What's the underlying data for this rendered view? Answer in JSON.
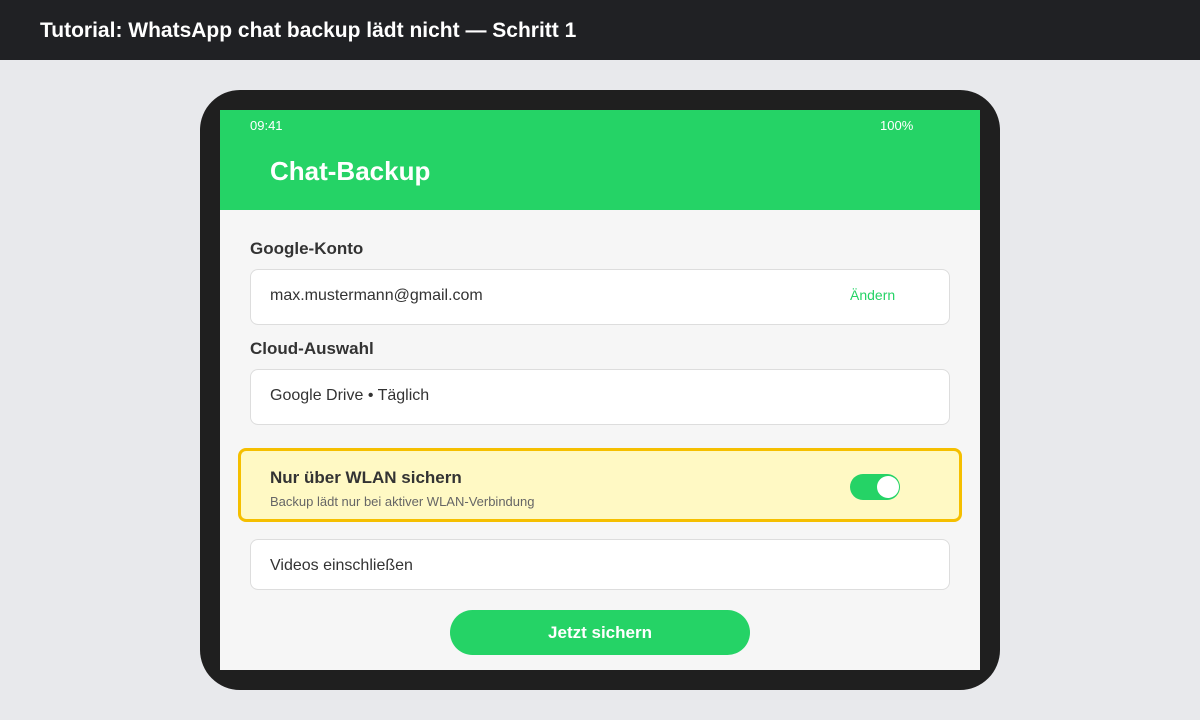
{
  "topbar": {
    "title": "Tutorial: WhatsApp chat backup lädt nicht — Schritt 1"
  },
  "status_bar": {
    "time": "09:41",
    "battery": "100%"
  },
  "app": {
    "title": "Chat-Backup"
  },
  "google_account": {
    "label": "Google-Konto",
    "email": "max.mustermann@gmail.com",
    "change_label": "Ändern"
  },
  "cloud": {
    "label": "Cloud-Auswahl",
    "selection": "Google Drive • Täglich"
  },
  "wlan_option": {
    "title": "Nur über WLAN sichern",
    "description": "Backup lädt nur bei aktiver WLAN-Verbindung",
    "enabled": true
  },
  "videos_option": {
    "label": "Videos einschließen"
  },
  "backup_button": {
    "label": "Jetzt sichern"
  },
  "colors": {
    "brand_green": "#25d366",
    "highlight_fill": "#fff9c4",
    "highlight_border": "#f5bf00",
    "topbar": "#202124"
  }
}
